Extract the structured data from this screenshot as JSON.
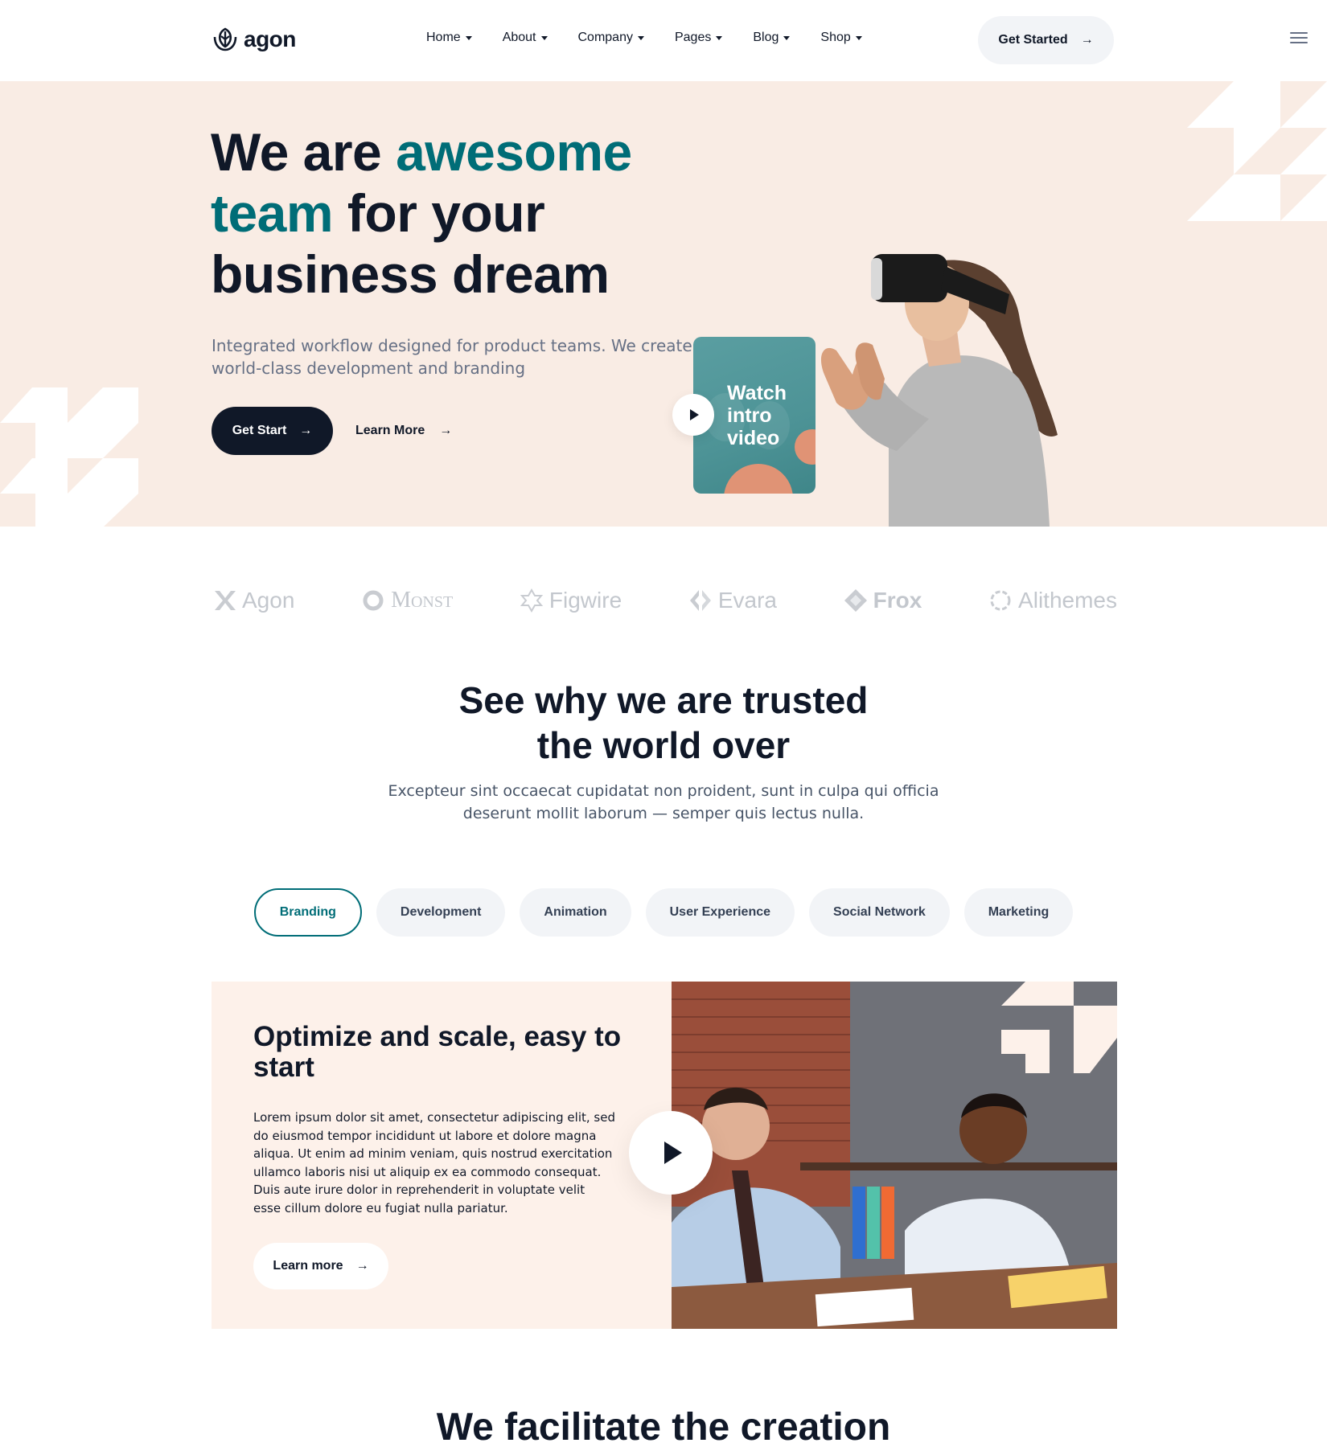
{
  "header": {
    "brand": "agon",
    "nav": [
      {
        "label": "Home"
      },
      {
        "label": "About"
      },
      {
        "label": "Company"
      },
      {
        "label": "Pages"
      },
      {
        "label": "Blog"
      },
      {
        "label": "Shop"
      }
    ],
    "cta_label": "Get Started",
    "cta_icon": "→"
  },
  "hero": {
    "title_part1": "We are ",
    "title_accent1": "awesome",
    "title_accent2": "team",
    "title_part2": " for your business dream",
    "subtitle": "Integrated workflow designed for product teams. We create world-class development and branding",
    "primary_button": "Get Start",
    "secondary_button": "Learn More",
    "arrow": "→",
    "video_card_text": "Watch intro video"
  },
  "logos": [
    {
      "name": "Agon"
    },
    {
      "name": "Monst"
    },
    {
      "name": "Figwire"
    },
    {
      "name": "Evara"
    },
    {
      "name": "Frox"
    },
    {
      "name": "Alithemes"
    }
  ],
  "trusted": {
    "title_line1": "See why we are trusted",
    "title_line2": "the world over",
    "subtitle_line1": "Excepteur sint occaecat cupidatat non proident, sunt in culpa qui officia",
    "subtitle_line2": "deserunt mollit laborum — semper quis lectus nulla."
  },
  "tabs": [
    {
      "label": "Branding",
      "active": true
    },
    {
      "label": "Development",
      "active": false
    },
    {
      "label": "Animation",
      "active": false
    },
    {
      "label": "User Experience",
      "active": false
    },
    {
      "label": "Social Network",
      "active": false
    },
    {
      "label": "Marketing",
      "active": false
    }
  ],
  "feature": {
    "title": "Optimize and scale, easy to start",
    "body": "Lorem ipsum dolor sit amet, consectetur adipiscing elit, sed do eiusmod tempor incididunt ut labore et dolore magna aliqua. Ut enim ad minim veniam, quis nostrud exercitation ullamco laboris nisi ut aliquip ex ea commodo consequat. Duis aute irure dolor in reprehenderit in voluptate velit esse cillum dolore eu fugiat nulla pariatur.",
    "button": "Learn more",
    "arrow": "→"
  },
  "next_section": {
    "title": "We facilitate the creation"
  },
  "colors": {
    "primary_dark": "#101828",
    "accent_teal": "#006d77",
    "hero_bg": "#f9ece4",
    "feature_bg": "#fdf1ea",
    "pill_bg": "#f2f4f7",
    "video_teal": "#4d9396",
    "coral": "#e09375"
  }
}
